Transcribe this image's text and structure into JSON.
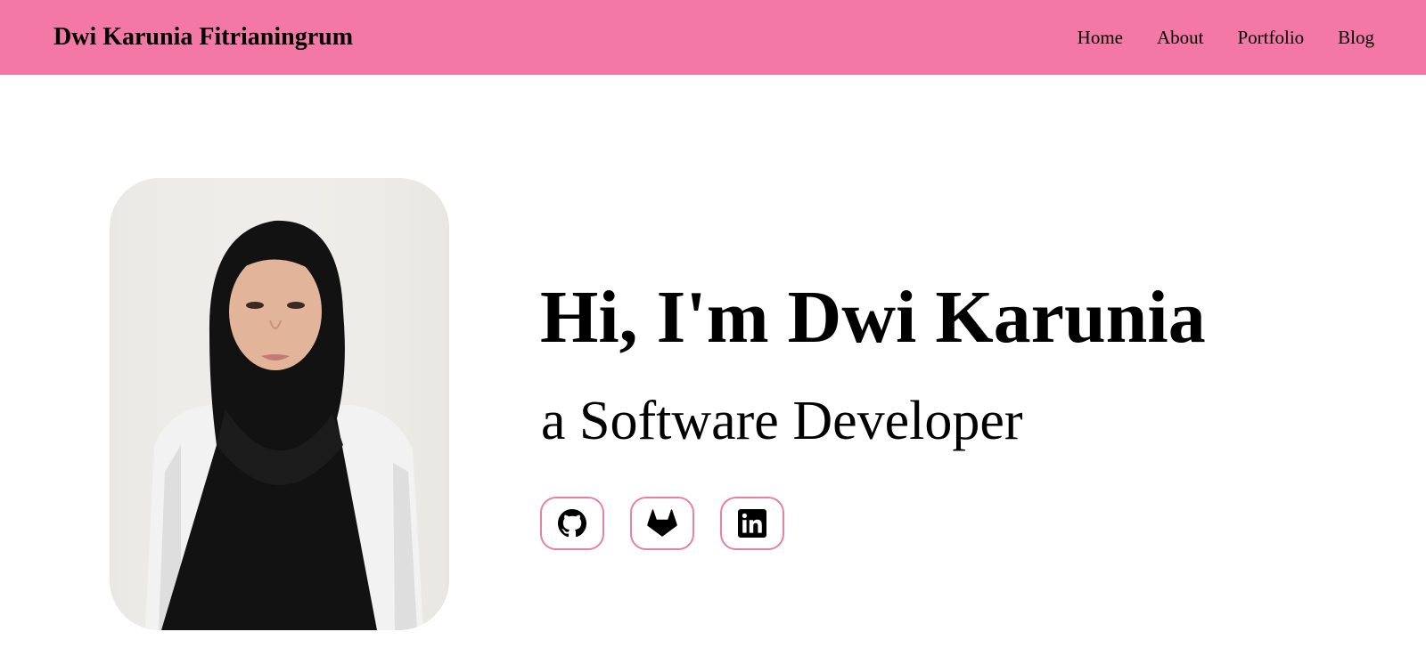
{
  "navbar": {
    "brand": "Dwi Karunia Fitrianingrum",
    "links": [
      "Home",
      "About",
      "Portfolio",
      "Blog"
    ],
    "background": "#f478a5"
  },
  "hero": {
    "title": "Hi, I'm Dwi Karunia",
    "subtitle": "a Software Developer",
    "photo_icon": "profile-photo",
    "socials": [
      {
        "icon": "github-icon"
      },
      {
        "icon": "gitlab-icon"
      },
      {
        "icon": "linkedin-icon"
      }
    ],
    "accent_border": "#e97fa6"
  }
}
